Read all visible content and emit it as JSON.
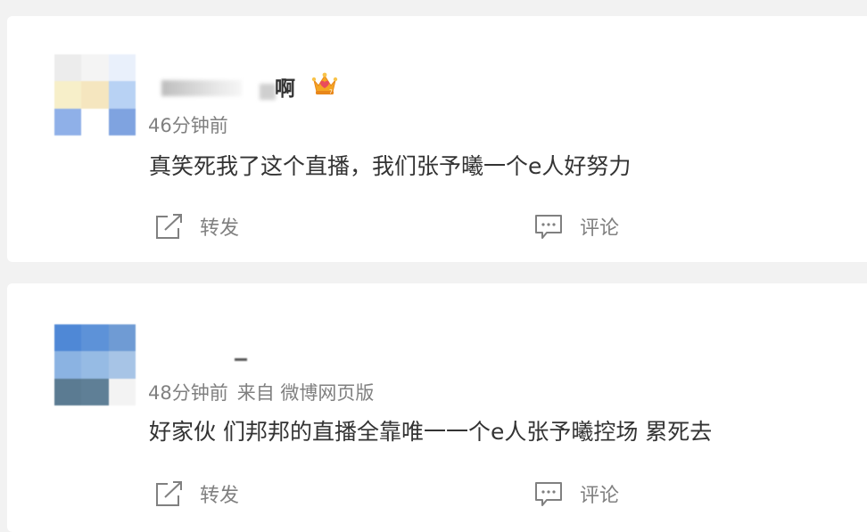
{
  "posts": [
    {
      "username_suffix": "啊",
      "meta": {
        "time": "46分钟前",
        "source": ""
      },
      "content": "真笑死我了这个直播，我们张予曦一个e人好努力",
      "actions": {
        "repost_label": "转发",
        "comment_label": "评论"
      },
      "badge_icon": "crown-badge-icon"
    },
    {
      "username_suffix": "",
      "meta": {
        "time": "48分钟前",
        "source": "来自 微博网页版"
      },
      "content": "好家伙 们邦邦的直播全靠唯一一个e人张予曦控场 累死去",
      "actions": {
        "repost_label": "转发",
        "comment_label": "评论"
      }
    }
  ],
  "icons": {
    "repost": "repost-icon",
    "comment": "comment-icon"
  }
}
